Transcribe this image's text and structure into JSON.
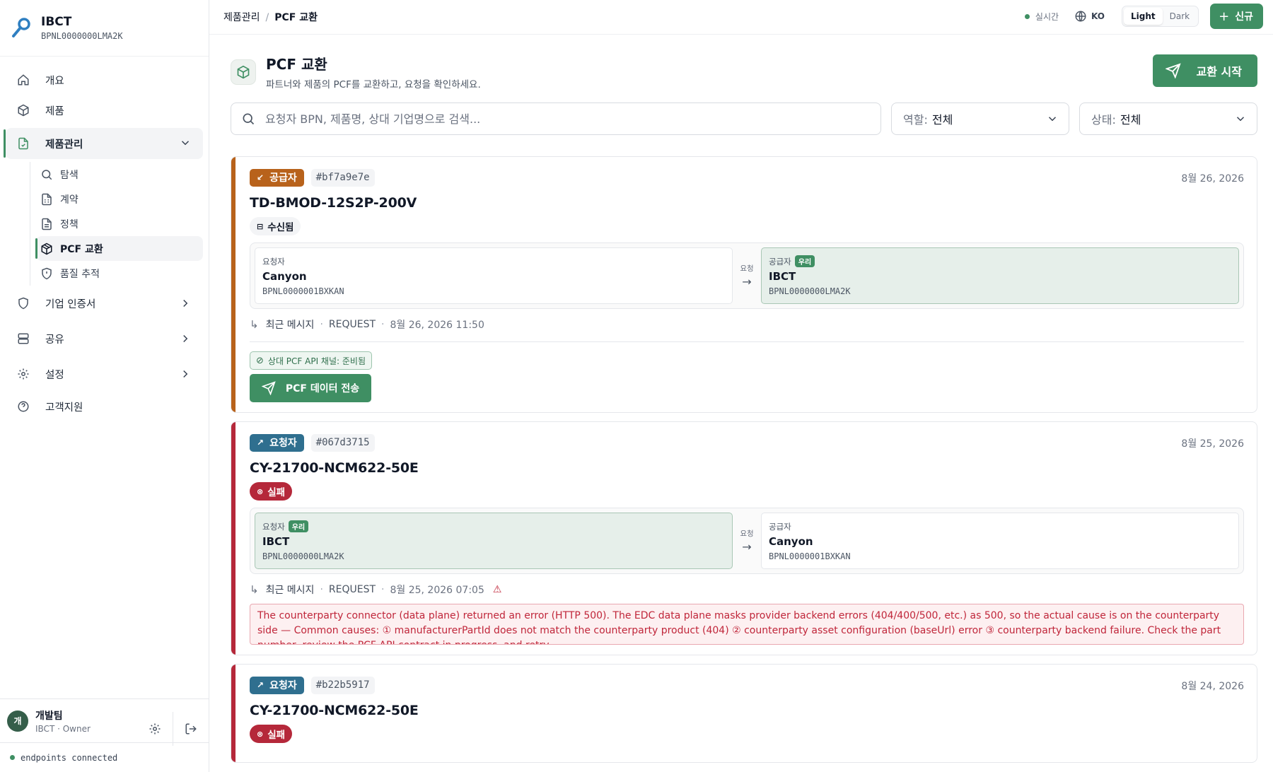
{
  "brand": {
    "name": "IBCT",
    "bpn": "BPNL0000000LMA2K"
  },
  "nav": {
    "overview": "개요",
    "products": "제품",
    "product_mgmt": "제품관리",
    "sub": {
      "explore": "탐색",
      "contract": "계약",
      "policy": "정책",
      "pcf_exchange": "PCF 교환",
      "quality": "품질 추적"
    },
    "certs": "기업 인증서",
    "share": "공유",
    "settings": "설정",
    "support": "고객지원"
  },
  "user": {
    "avatar": "개",
    "name": "개발팀",
    "role": "IBCT · Owner"
  },
  "connection": "endpoints connected",
  "topbar": {
    "crumb_parent": "제품관리",
    "crumb_current": "PCF 교환",
    "live": "실시간",
    "lang": "KO",
    "theme_light": "Light",
    "theme_dark": "Dark",
    "new_label": "신규"
  },
  "page": {
    "title": "PCF 교환",
    "subtitle": "파트너와 제품의 PCF를 교환하고, 요청을 확인하세요.",
    "start_label": "교환 시작"
  },
  "filters": {
    "search_placeholder": "요청자 BPN, 제품명, 상대 기업명으로 검색...",
    "role_label": "역할:",
    "role_value": "전체",
    "status_label": "상태:",
    "status_value": "전체"
  },
  "colors": {
    "accent": "#3f8f63",
    "supplier": "#b8621b",
    "requester": "#2f6f8f",
    "failed": "#b5283a"
  },
  "cards": [
    {
      "role": "공급자",
      "hash": "#bf7a9e7e",
      "date": "8월 26, 2026",
      "product": "TD-BMOD-12S2P-200V",
      "status": "수신됨",
      "left": {
        "label": "요청자",
        "name": "Canyon",
        "bpn": "BPNL0000001BXKAN"
      },
      "mid": "요청",
      "right": {
        "label": "공급자",
        "ours": "우리",
        "name": "IBCT",
        "bpn": "BPNL0000000LMA2K"
      },
      "last_label": "최근 메시지",
      "msg_type": "REQUEST",
      "msg_time": "8월 26, 2026 11:50",
      "api_badge": "상대 PCF API 채널: 준비됨",
      "send_label": "PCF 데이터 전송"
    },
    {
      "role": "요청자",
      "hash": "#067d3715",
      "date": "8월 25, 2026",
      "product": "CY-21700-NCM622-50E",
      "status": "실패",
      "left": {
        "label": "요청자",
        "ours": "우리",
        "name": "IBCT",
        "bpn": "BPNL0000000LMA2K"
      },
      "mid": "요청",
      "right": {
        "label": "공급자",
        "name": "Canyon",
        "bpn": "BPNL0000001BXKAN"
      },
      "last_label": "최근 메시지",
      "msg_type": "REQUEST",
      "msg_time": "8월 25, 2026 07:05",
      "error": "The counterparty connector (data plane) returned an error (HTTP 500). The EDC data plane masks provider backend errors (404/400/500, etc.) as 500, so the actual cause is on the counterparty side — Common causes: ① manufacturerPartId does not match the counterparty product (404) ② counterparty asset configuration (baseUrl) error ③ counterparty backend failure. Check the part number, review the PCF API contract in progress, and retry."
    },
    {
      "role": "요청자",
      "hash": "#b22b5917",
      "date": "8월 24, 2026",
      "product": "CY-21700-NCM622-50E",
      "status": "실패"
    }
  ]
}
